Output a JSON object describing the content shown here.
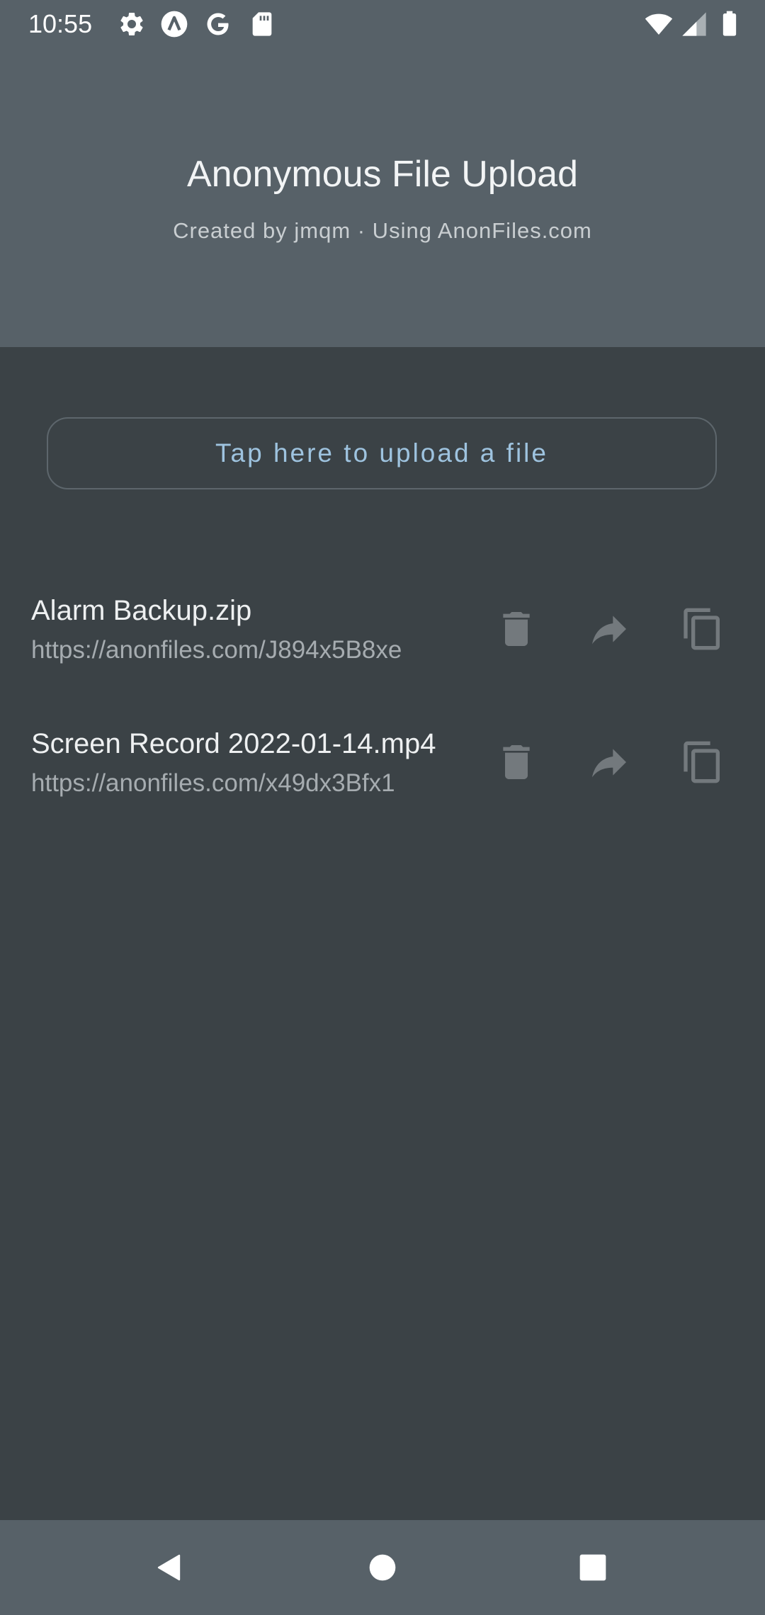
{
  "status_bar": {
    "time": "10:55",
    "left_icons": [
      "settings-icon",
      "app-a-icon",
      "google-icon",
      "sd-card-icon"
    ],
    "right_icons": [
      "wifi-icon",
      "signal-icon",
      "battery-icon"
    ]
  },
  "header": {
    "title": "Anonymous File Upload",
    "subtitle": "Created by jmqm · Using AnonFiles.com"
  },
  "upload": {
    "label": "Tap here to upload a file"
  },
  "files": [
    {
      "name": "Alarm Backup.zip",
      "url": "https://anonfiles.com/J894x5B8xe",
      "actions": [
        "delete-icon",
        "share-icon",
        "copy-icon"
      ]
    },
    {
      "name": "Screen Record 2022-01-14.mp4",
      "url": "https://anonfiles.com/x49dx3Bfx1",
      "actions": [
        "delete-icon",
        "share-icon",
        "copy-icon"
      ]
    }
  ],
  "nav_bar": {
    "buttons": [
      "back-icon",
      "home-icon",
      "recents-icon"
    ]
  },
  "colors": {
    "header_bg": "#576168",
    "body_bg": "#3b4246",
    "accent": "#9ec3df",
    "icon_muted": "#73797d"
  }
}
